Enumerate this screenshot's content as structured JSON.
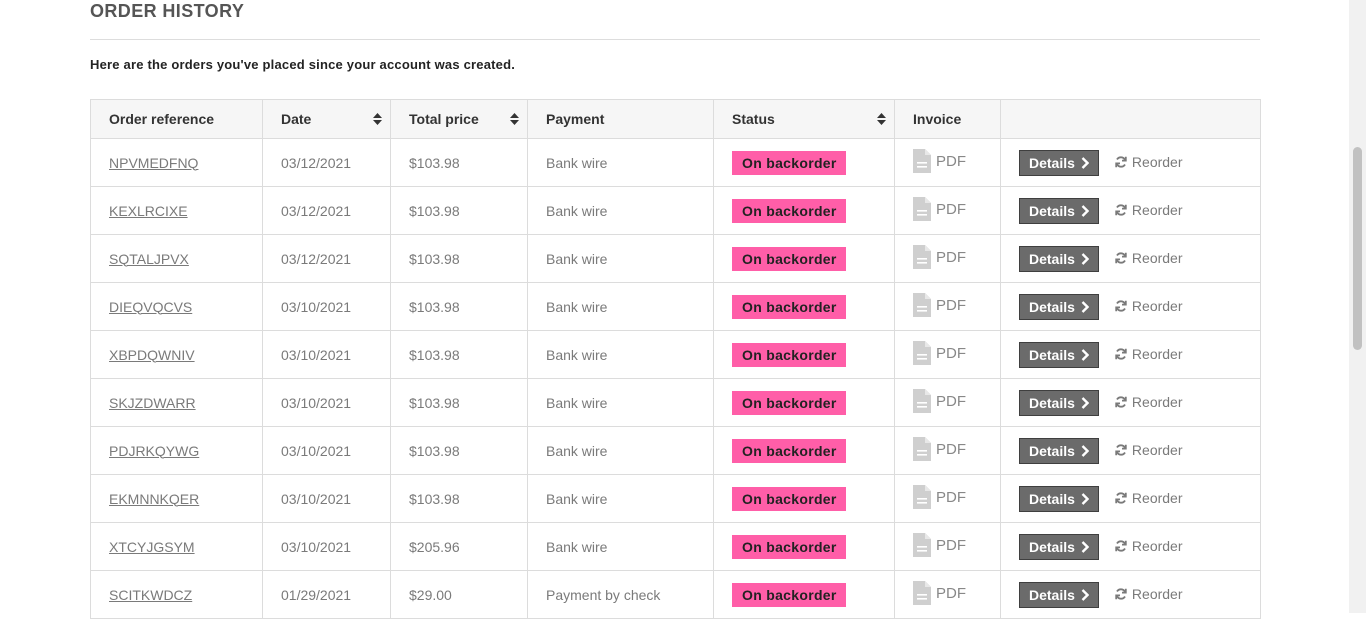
{
  "page": {
    "title": "ORDER HISTORY",
    "intro": "Here are the orders you've placed since your account was created."
  },
  "table": {
    "headers": {
      "reference": "Order reference",
      "date": "Date",
      "total": "Total price",
      "payment": "Payment",
      "status": "Status",
      "invoice": "Invoice"
    },
    "rows": [
      {
        "reference": "NPVMEDFNQ",
        "date": "03/12/2021",
        "total": "$103.98",
        "payment": "Bank wire",
        "status": "On backorder",
        "invoice": "PDF",
        "details": "Details",
        "reorder": "Reorder"
      },
      {
        "reference": "KEXLRCIXE",
        "date": "03/12/2021",
        "total": "$103.98",
        "payment": "Bank wire",
        "status": "On backorder",
        "invoice": "PDF",
        "details": "Details",
        "reorder": "Reorder"
      },
      {
        "reference": "SQTALJPVX",
        "date": "03/12/2021",
        "total": "$103.98",
        "payment": "Bank wire",
        "status": "On backorder",
        "invoice": "PDF",
        "details": "Details",
        "reorder": "Reorder"
      },
      {
        "reference": "DIEQVQCVS",
        "date": "03/10/2021",
        "total": "$103.98",
        "payment": "Bank wire",
        "status": "On backorder",
        "invoice": "PDF",
        "details": "Details",
        "reorder": "Reorder"
      },
      {
        "reference": "XBPDQWNIV",
        "date": "03/10/2021",
        "total": "$103.98",
        "payment": "Bank wire",
        "status": "On backorder",
        "invoice": "PDF",
        "details": "Details",
        "reorder": "Reorder"
      },
      {
        "reference": "SKJZDWARR",
        "date": "03/10/2021",
        "total": "$103.98",
        "payment": "Bank wire",
        "status": "On backorder",
        "invoice": "PDF",
        "details": "Details",
        "reorder": "Reorder"
      },
      {
        "reference": "PDJRKQYWG",
        "date": "03/10/2021",
        "total": "$103.98",
        "payment": "Bank wire",
        "status": "On backorder",
        "invoice": "PDF",
        "details": "Details",
        "reorder": "Reorder"
      },
      {
        "reference": "EKMNNKQER",
        "date": "03/10/2021",
        "total": "$103.98",
        "payment": "Bank wire",
        "status": "On backorder",
        "invoice": "PDF",
        "details": "Details",
        "reorder": "Reorder"
      },
      {
        "reference": "XTCYJGSYM",
        "date": "03/10/2021",
        "total": "$205.96",
        "payment": "Bank wire",
        "status": "On backorder",
        "invoice": "PDF",
        "details": "Details",
        "reorder": "Reorder"
      },
      {
        "reference": "SCITKWDCZ",
        "date": "01/29/2021",
        "total": "$29.00",
        "payment": "Payment by check",
        "status": "On backorder",
        "invoice": "PDF",
        "details": "Details",
        "reorder": "Reorder"
      }
    ]
  },
  "icons": {
    "sort": "sort-icon",
    "invoice": "file-icon",
    "details": "chevron-right-icon",
    "reorder": "refresh-icon"
  },
  "colors": {
    "status_badge": "#ff5ea8",
    "details_button": "#6b6b6b"
  }
}
